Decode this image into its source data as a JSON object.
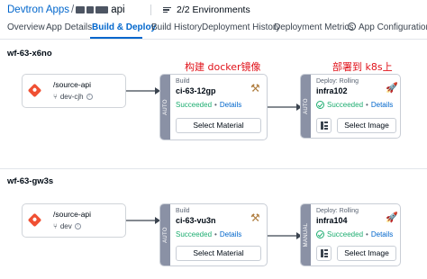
{
  "header": {
    "app_link": "Devtron Apps",
    "sep": "/",
    "app_name": "api",
    "environments": "2/2 Environments"
  },
  "tabs": [
    {
      "label": "Overview"
    },
    {
      "label": "App Details"
    },
    {
      "label": "Build & Deploy",
      "active": true
    },
    {
      "label": "Build History"
    },
    {
      "label": "Deployment History"
    },
    {
      "label": "Deployment Metrics"
    },
    {
      "label": "App Configuration"
    }
  ],
  "workflows": [
    {
      "title": "wf-63-x6no",
      "source": {
        "path": "/source-api",
        "branch": "dev-cjh"
      },
      "build": {
        "trigger": "AUTO",
        "kind": "Build",
        "name": "ci-63-12gp",
        "status": "Succeeded",
        "details": "Details",
        "button": "Select Material",
        "annotation": "构建 docker镜像"
      },
      "deploy": {
        "trigger": "AUTO",
        "kind": "Deploy: Rolling",
        "name": "infra102",
        "status": "Succeeded",
        "details": "Details",
        "button": "Select Image",
        "annotation": "部署到 k8s上"
      }
    },
    {
      "title": "wf-63-gw3s",
      "source": {
        "path": "/source-api",
        "branch": "dev"
      },
      "build": {
        "trigger": "AUTO",
        "kind": "Build",
        "name": "ci-63-vu3n",
        "status": "Succeeded",
        "details": "Details",
        "button": "Select Material"
      },
      "deploy": {
        "trigger": "MANUAL",
        "kind": "Deploy: Rolling",
        "name": "infra104",
        "status": "Succeeded",
        "details": "Details",
        "button": "Select Image"
      }
    }
  ],
  "colors": {
    "accent": "#0066cc",
    "success": "#1dad70",
    "annotation": "#e0121a",
    "trigger_bar": "#8a91a5"
  },
  "icons": [
    "git-icon",
    "branch-icon",
    "info-icon",
    "tools-icon",
    "rocket-icon",
    "check-circle-icon",
    "bars-icon",
    "gear-icon",
    "hamburger-icon"
  ]
}
